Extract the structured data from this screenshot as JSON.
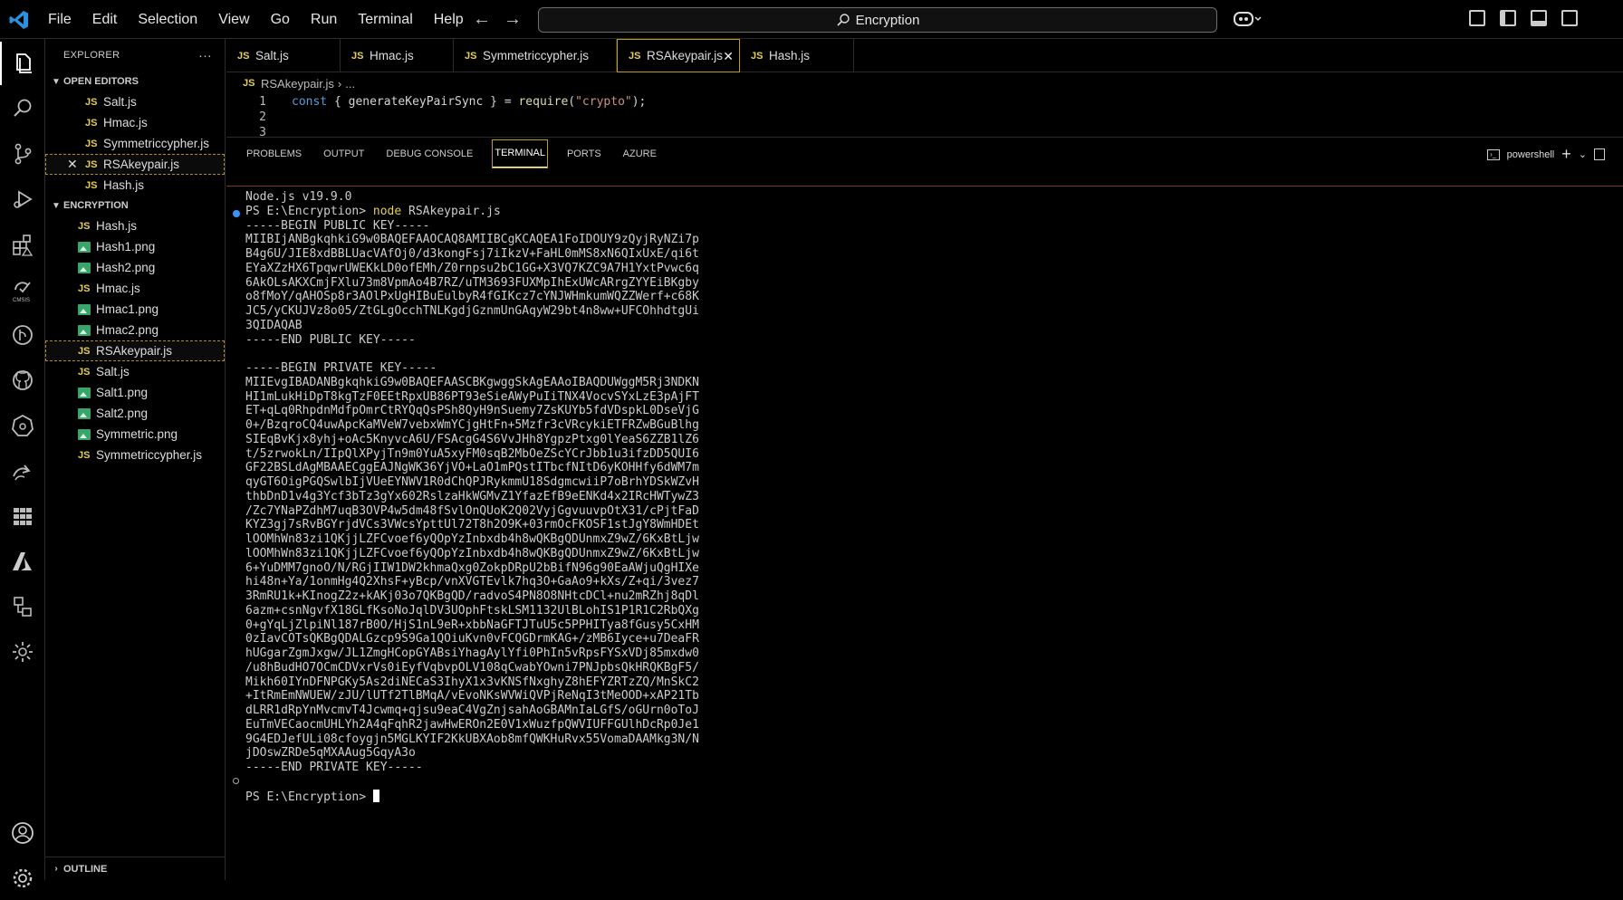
{
  "menu": [
    "File",
    "Edit",
    "Selection",
    "View",
    "Go",
    "Run",
    "Terminal",
    "Help"
  ],
  "command_center": "Encryption",
  "explorer": {
    "title": "EXPLORER",
    "more": "···",
    "open_editors_title": "OPEN EDITORS",
    "open_editors": [
      "Salt.js",
      "Hmac.js",
      "Symmetriccypher.js",
      "RSAkeypair.js",
      "Hash.js"
    ],
    "folder_title": "ENCRYPTION",
    "files": [
      {
        "name": "Hash.js",
        "type": "js"
      },
      {
        "name": "Hash1.png",
        "type": "png"
      },
      {
        "name": "Hash2.png",
        "type": "png"
      },
      {
        "name": "Hmac.js",
        "type": "js"
      },
      {
        "name": "Hmac1.png",
        "type": "png"
      },
      {
        "name": "Hmac2.png",
        "type": "png"
      },
      {
        "name": "RSAkeypair.js",
        "type": "js"
      },
      {
        "name": "Salt.js",
        "type": "js"
      },
      {
        "name": "Salt1.png",
        "type": "png"
      },
      {
        "name": "Salt2.png",
        "type": "png"
      },
      {
        "name": "Symmetric.png",
        "type": "png"
      },
      {
        "name": "Symmetriccypher.js",
        "type": "js"
      }
    ],
    "outline_title": "OUTLINE"
  },
  "tabs": [
    "Salt.js",
    "Hmac.js",
    "Symmetriccypher.js",
    "RSAkeypair.js",
    "Hash.js"
  ],
  "js_badge": "JS",
  "breadcrumb": {
    "file": "RSAkeypair.js",
    "sep": "›",
    "rest": "..."
  },
  "editor": {
    "line1_num": "1",
    "line1": {
      "kw": "const",
      "p1": " { ",
      "fn": "generateKeyPairSync",
      "p2": " } = ",
      "req": "require",
      "p3": "(",
      "str": "\"crypto\"",
      "p4": ");"
    },
    "line2_num": "2",
    "line3_num": "3"
  },
  "panel_tabs": [
    "PROBLEMS",
    "OUTPUT",
    "DEBUG CONSOLE",
    "TERMINAL",
    "PORTS",
    "AZURE"
  ],
  "shell": "powershell",
  "terminal": {
    "node_version": "Node.js v19.9.0",
    "prompt": "PS E:\\Encryption>",
    "command": "node",
    "command_arg": "RSAkeypair.js",
    "public_begin": "-----BEGIN PUBLIC KEY-----",
    "public_lines": [
      "MIIBIjANBgkqhkiG9w0BAQEFAAOCAQ8AMIIBCgKCAQEA1FoIDOUY9zQyjRyNZi7p",
      "B4g6U/JIE8xdBBLUacVAfOj0/d3kongFsj7iIkzV+FaHL0mMS8xN6QIxUxE/qi6t",
      "EYaXZzHX6TpqwrUWEKkLD0ofEMh/Z0rnpsu2bC1GG+X3VQ7KZC9A7H1YxtPvwc6q",
      "6AkOLsAKXCmjFXlu73m8VpmAo4B7RZ/uTM3693FUXMpIhExUWcARrgZYYEiBKgby",
      "o8fMoY/qAHOSp8r3AOlPxUgHIBuEulbyR4fGIKcz7cYNJWHmkumWQZZWerf+c68K",
      "JC5/yCKUJVz8o05/ZtGLgOcchTNLKgdjGznmUnGAqyW29bt4n8ww+UFCOhhdtgUi",
      "3QIDAQAB"
    ],
    "public_end": "-----END PUBLIC KEY-----",
    "private_begin": "-----BEGIN PRIVATE KEY-----",
    "private_lines": [
      "MIIEvgIBADANBgkqhkiG9w0BAQEFAASCBKgwggSkAgEAAoIBAQDUWggM5Rj3NDKN",
      "HI1mLukHiDpT8kgTzF0EEtRpxUB86PT93eSieAWyPuIiTNX4VocvSYxLzE3pAjFT",
      "ET+qLq0RhpdnMdfpOmrCtRYQqQsPSh8QyH9nSuemy7ZsKUYb5fdVDspkL0DseVjG",
      "0+/BzqroCQ4uwApcKaMVeW7vebxWmYCjgHtFn+5Mzfr3cVRcykiETFRZwBGuBlhg",
      "SIEqBvKjx8yhj+oAc5KnyvcA6U/FSAcgG4S6VvJHh8YgpzPtxg0lYeaS6ZZB1lZ6",
      "t/5zrwokLn/IIpQlXPyjTn9m0YuA5xyFM0sqB2MbOeZScYCrJbb1u3ifzDD5QUI6",
      "GF22BSLdAgMBAAECggEAJNgWK36YjVO+LaO1mPQstITbcfNItD6yKOHHfy6dWM7m",
      "qyGT6OigPGQSwlbIjVUeEYNWV1R0dChQPJRykmmU18SdgmcwiiP7oBrhYDSkWZvH",
      "thbDnD1v4g3Ycf3bTz3gYx602RslzaHkWGMvZ1YfazEfB9eENKd4x2IRcHWTywZ3",
      "/Zc7YNaPZdhM7uqB3OVP4w5dm48fSvlOnQUoK2Q02VyjGgvuuvpOtX31/cPjtFaD",
      "KYZ3gj7sRvBGYrjdVCs3VWcsYpttUl72T8h2O9K+03rmOcFKOSF1stJgY8WmHDEt",
      "lOOMhWn83zi1QKjjLZFCvoef6yQOpYzInbxdb4h8wQKBgQDUnmxZ9wZ/6KxBtLjw",
      "lOOMhWn83zi1QKjjLZFCvoef6yQOpYzInbxdb4h8wQKBgQDUnmxZ9wZ/6KxBtLjw",
      "6+YuDMM7gnoO/N/RGjIIW1DW2khmaQxg0ZokpDRpU2bBifN96g90EaAWjuQgHIXe",
      "hi48n+Ya/1onmHg4Q2XhsF+yBcp/vnXVGTEvlk7hq3O+GaAo9+kXs/Z+qi/3vez7",
      "3RmRU1k+KInogZ2z+kAKj03o7QKBgQD/radvoS4PN8O8NHtcDCl+nu2mRZhj8qDl",
      "6azm+csnNgvfX18GLfKsoNoJqlDV3UOphFtskLSM1132UlBLohIS1P1R1C2RbQXg",
      "0+gYqLjZlpiNl187rB0O/HjS1nL9eR+xbbNaGFTJTuU5c5PPHITya8fGusy5CxHM",
      "0zIavCOTsQKBgQDALGzcp9S9Ga1QOiuKvn0vFCQGDrmKAG+/zMB6Iyce+u7DeaFR",
      "hUGgarZgmJxgw/JL1ZmgHCopGYABsiYhagAylYfi0PhIn5vRpsFYSxVDj85mxdw0",
      "/u8hBudHO7OCmCDVxrVs0iEyfVqbvpOLV108qCwabYOwni7PNJpbsQkHRQKBgF5/",
      "Mikh60IYnDFNPGKy5As2diNECaS3IhyX1x3vKNSfNxghyZ8hEFYZRTzZQ/MnSkC2",
      "+ItRmEmNWUEW/zJU/lUTf2TlBMqA/vEvoNKsWVWiQVPjReNqI3tMeOOD+xAP21Tb",
      "dLRR1dRpYnMvcmvT4Jcwmq+qjsu9eaC4VgZnjsahAoGBAMnIaLGfS/oGUrn0oToJ",
      "EuTmVECaocmUHLYh2A4qFqhR2jawHwEROn2E0V1xWuzfpQWVIUFFGUlhDcRp0Je1",
      "9G4EDJefULi08cfoygjn5MGLKYIF2KkUBXAob8mfQWKHuRvx55VomaDAAMkg3N/N",
      "jDOswZRDe5qMXAAug5GqyA3o"
    ],
    "private_end": "-----END PRIVATE KEY-----",
    "final_prompt": "PS E:\\Encryption>"
  },
  "colors": {
    "accent_tab_border": "#c29a2a",
    "js": "#e6d04c",
    "png": "#3aa56a",
    "string": "#ce9178",
    "keyword": "#569cd6",
    "function": "#dcdcaa",
    "dot_blue": "#3794ff"
  }
}
